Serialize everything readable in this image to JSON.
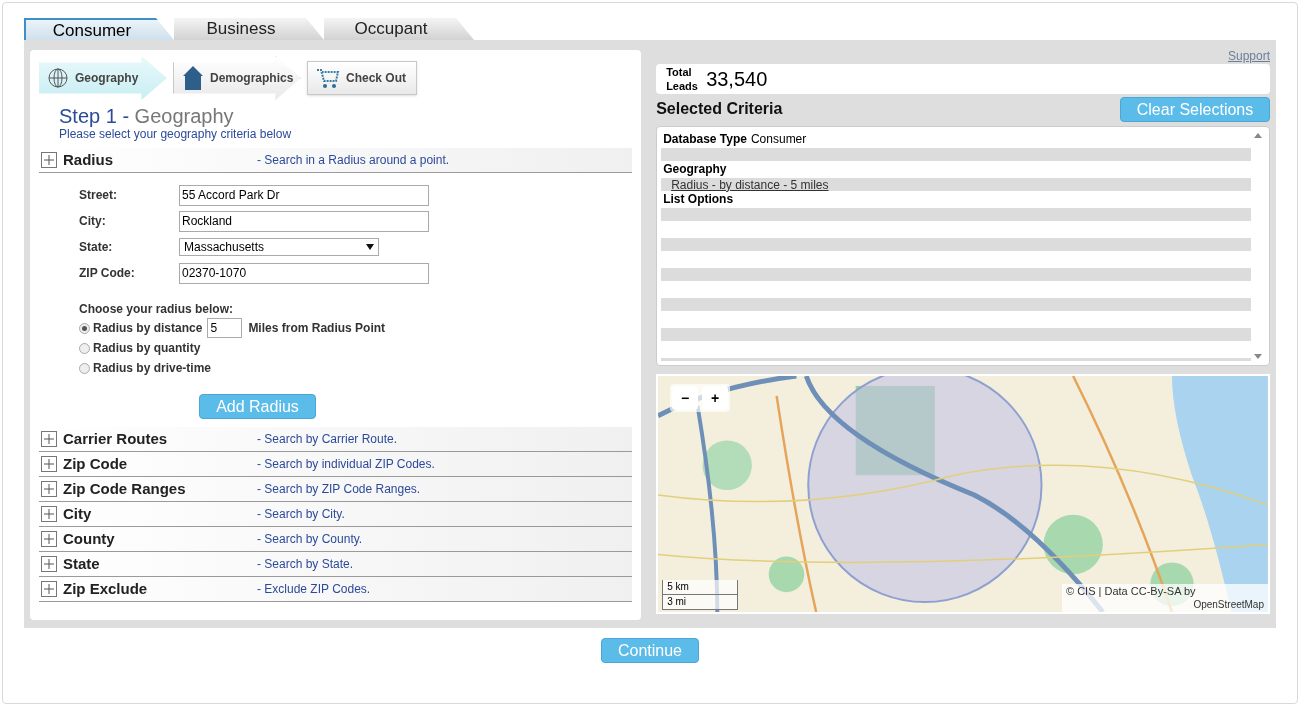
{
  "tabs": [
    {
      "label": "Consumer",
      "selected": true
    },
    {
      "label": "Business",
      "selected": false
    },
    {
      "label": "Occupant",
      "selected": false
    }
  ],
  "steps": [
    {
      "label": "Geography",
      "kind": "globe",
      "selected": true
    },
    {
      "label": "Demographics",
      "kind": "house",
      "selected": false
    },
    {
      "label": "Check Out",
      "kind": "cart",
      "selected": false
    }
  ],
  "heading": {
    "step": "Step 1 -",
    "name": "Geography",
    "subtitle": "Please select your geography criteria below"
  },
  "sections": [
    {
      "title": "Radius",
      "description": "- Search in a Radius around a point."
    },
    {
      "title": "Carrier Routes",
      "description": "- Search by Carrier Route."
    },
    {
      "title": "Zip Code",
      "description": "- Search by individual ZIP Codes."
    },
    {
      "title": "Zip Code Ranges",
      "description": "- Search by ZIP Code Ranges."
    },
    {
      "title": "City",
      "description": "- Search by City."
    },
    {
      "title": "County",
      "description": "- Search by County."
    },
    {
      "title": "State",
      "description": "- Search by State."
    },
    {
      "title": "Zip Exclude",
      "description": "- Exclude ZIP Codes."
    }
  ],
  "radius_form": {
    "fields": [
      {
        "label": "Street:",
        "value": "55 Accord Park Dr",
        "kind": "text"
      },
      {
        "label": "City:",
        "value": "Rockland",
        "kind": "text"
      },
      {
        "label": "State:",
        "value": "Massachusetts",
        "kind": "select"
      },
      {
        "label": "ZIP Code:",
        "value": "02370-1070",
        "kind": "text"
      }
    ],
    "prompt": "Choose your radius below:",
    "options": [
      {
        "label": "Radius by distance",
        "selected": true,
        "kind": "distance"
      },
      {
        "label": "Radius by quantity",
        "selected": false,
        "kind": "plain"
      },
      {
        "label": "Radius by drive-time",
        "selected": false,
        "kind": "plain"
      }
    ],
    "distance": "5",
    "distance_suffix": "Miles from Radius Point",
    "add_button": "Add Radius"
  },
  "support_link": "Support",
  "total_leads": {
    "label": "Total Leads",
    "count": "33,540"
  },
  "selected_criteria": {
    "title": "Selected Criteria",
    "clear_button": "Clear Selections",
    "groups": [
      {
        "label": "Database Type",
        "value": "Consumer"
      },
      {
        "label": "Geography",
        "items": [
          "Radius - by distance - 5 miles"
        ]
      },
      {
        "label": "List Options"
      }
    ]
  },
  "map": {
    "zoom_out": "−",
    "zoom_in": "+",
    "scale": [
      "5 km",
      "3 mi"
    ],
    "attribution": "© CIS | Data CC-By-SA by",
    "attribution_link": "OpenStreetMap"
  },
  "continue_button": "Continue"
}
